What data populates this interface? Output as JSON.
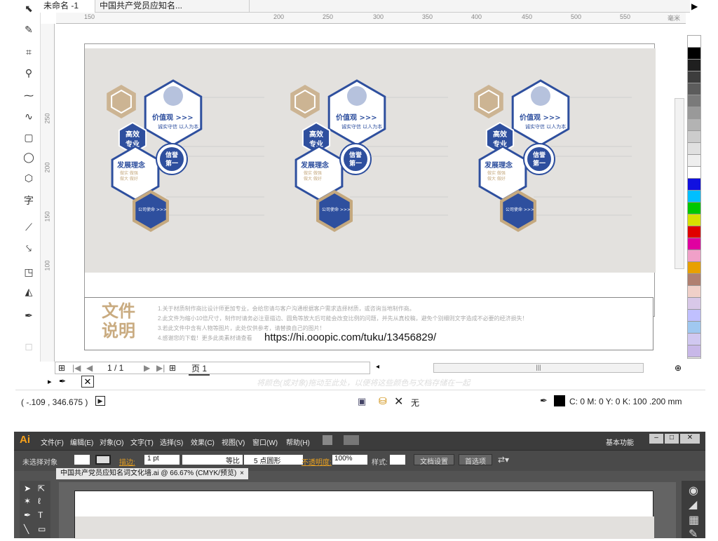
{
  "corel": {
    "tabs": [
      "未命名 -1",
      "中国共产党员应知名..."
    ],
    "ruler_h": [
      "150",
      "200",
      "250",
      "300",
      "350",
      "400",
      "450",
      "500",
      "550",
      "毫米"
    ],
    "ruler_v": [
      "250",
      "200",
      "150",
      "100"
    ],
    "pager": {
      "count": "1 / 1",
      "page": "页 1"
    },
    "hscroll_label": "|||",
    "hint": "将颜色(或对象)拖动至此处，以便将这些颜色与文档存储在一起",
    "status": {
      "coords": "( -.109 , 346.675 )",
      "fill": "无",
      "color_values": "C: 0 M: 0 Y: 0 K: 100  .200 mm"
    },
    "palette": [
      "#ffffff",
      "#000000",
      "#1f1f1f",
      "#3d3d3d",
      "#5c5c5c",
      "#7a7a7a",
      "#999999",
      "#b3b3b3",
      "#cccccc",
      "#e0e0e0",
      "#eeeeee",
      "#ffffff",
      "#1010e0",
      "#00bfff",
      "#00c800",
      "#d8e000",
      "#e00000",
      "#e000a0",
      "#f0a0c8",
      "#e8a000",
      "#b08070",
      "#f0d0c8",
      "#d8c8e8",
      "#c0c0ff",
      "#a0c8f0",
      "#d0c8f0",
      "#c8b8e8"
    ]
  },
  "panel": {
    "value_title": "价值观 >>>",
    "value_sub": "诚实守信  以人为本",
    "eff_line1": "高效",
    "eff_line2": "专业",
    "trust_line1": "信誉",
    "trust_line2": "第一",
    "dev_title": "发展理念",
    "dev_sub1": "做实  做强",
    "dev_sub2": "做大  做好",
    "mission": "公司使命 >>>"
  },
  "note": {
    "title": "文件说明",
    "lines": [
      "1.关于材质制作商比设计师更加专业，会给您请与客户沟通根据客户需求选择材质，或咨询当地制作商。",
      "2.此文件为缩小10倍尺寸，制作时请务必注意描边、圆角等放大后可能会改变比例的问题，并先从真校稿，避免个别细则文字造成不必要的经济损失！",
      "3.若此文件中含有人物等图片，此处仅供参考，请替换自己的图片！",
      "4.感谢您的下载！更多此类素材请查看"
    ],
    "url": "https://hi.ooopic.com/tuku/13456829/"
  },
  "ai": {
    "logo": "Ai",
    "menu": [
      "文件(F)",
      "编辑(E)",
      "对象(O)",
      "文字(T)",
      "选择(S)",
      "效果(C)",
      "视图(V)",
      "窗口(W)",
      "帮助(H)"
    ],
    "workspace": "基本功能",
    "options": {
      "none_selected": "未选择对象",
      "stroke": "描边:",
      "stroke_val": "1 pt",
      "uniform": "等比",
      "brush": "5 点圆形",
      "opacity_label": "不透明度:",
      "opacity_val": "100%",
      "style": "样式:",
      "doc_setup": "文档设置",
      "prefs": "首选项"
    },
    "doc_tab": "中国共产党员应知名词文化墙.ai @ 66.67% (CMYK/预览)",
    "close": "×"
  },
  "colors": {
    "blue": "#2e4f9e",
    "gold": "#c5a97f",
    "gray_bg": "#e3e1de"
  }
}
